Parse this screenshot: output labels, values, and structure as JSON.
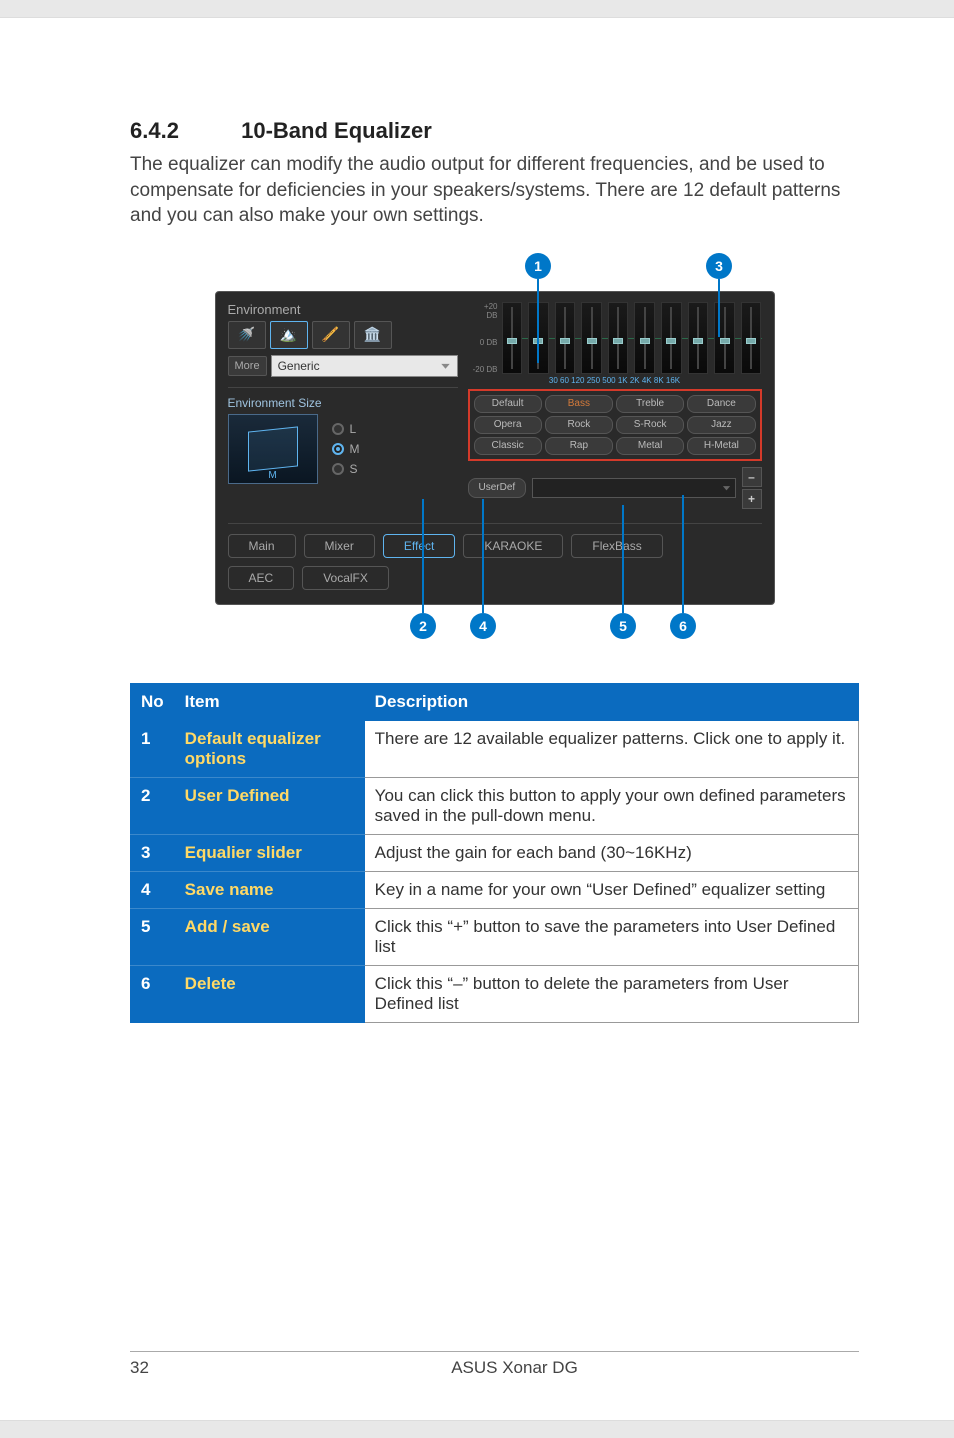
{
  "section": {
    "number": "6.4.2",
    "title": "10-Band Equalizer"
  },
  "intro": "The equalizer can modify the audio output for different frequencies, and be used to compensate for deficiencies in your speakers/systems. There are 12 default patterns and you can also make your own settings.",
  "panel": {
    "environment": {
      "title": "Environment",
      "more_label": "More",
      "selected": "Generic",
      "size_title": "Environment Size",
      "room_label": "M",
      "sizes": [
        {
          "label": "L",
          "selected": false
        },
        {
          "label": "M",
          "selected": true
        },
        {
          "label": "S",
          "selected": false
        }
      ]
    },
    "eq": {
      "y_ticks": [
        "+20 DB",
        "0 DB",
        "-20 DB"
      ],
      "x_label": "30  60  120 250 500  1K  2K  4K  8K 16K",
      "presets": [
        "Default",
        "Bass",
        "Treble",
        "Dance",
        "Opera",
        "Rock",
        "S-Rock",
        "Jazz",
        "Classic",
        "Rap",
        "Metal",
        "H-Metal"
      ],
      "userdef_label": "UserDef",
      "minus_label": "–",
      "plus_label": "+"
    },
    "tabs": {
      "row1": [
        "Main",
        "Mixer",
        "Effect",
        "KARAOKE",
        "FlexBass"
      ],
      "row2": [
        "AEC",
        "VocalFX"
      ],
      "active": "Effect"
    }
  },
  "callouts": {
    "c1": "1",
    "c2": "2",
    "c3": "3",
    "c4": "4",
    "c5": "5",
    "c6": "6"
  },
  "table": {
    "headers": {
      "no": "No",
      "item": "Item",
      "desc": "Description"
    },
    "rows": [
      {
        "no": "1",
        "item": "Default equalizer options",
        "desc": "There are 12 available equalizer patterns. Click one to apply it."
      },
      {
        "no": "2",
        "item": "User Defined",
        "desc": "You can click this button to apply your own defined parameters saved in the pull-down menu."
      },
      {
        "no": "3",
        "item": "Equalier slider",
        "desc": "Adjust the gain for each band (30~16KHz)"
      },
      {
        "no": "4",
        "item": "Save name",
        "desc": "Key in a name for your own “User Defined” equalizer setting"
      },
      {
        "no": "5",
        "item": "Add / save",
        "desc": "Click this “+” button to save the parameters into User Defined list"
      },
      {
        "no": "6",
        "item": "Delete",
        "desc": "Click this “–” button to delete the parameters from User Defined list"
      }
    ]
  },
  "footer": {
    "page": "32",
    "title": "ASUS Xonar DG"
  }
}
